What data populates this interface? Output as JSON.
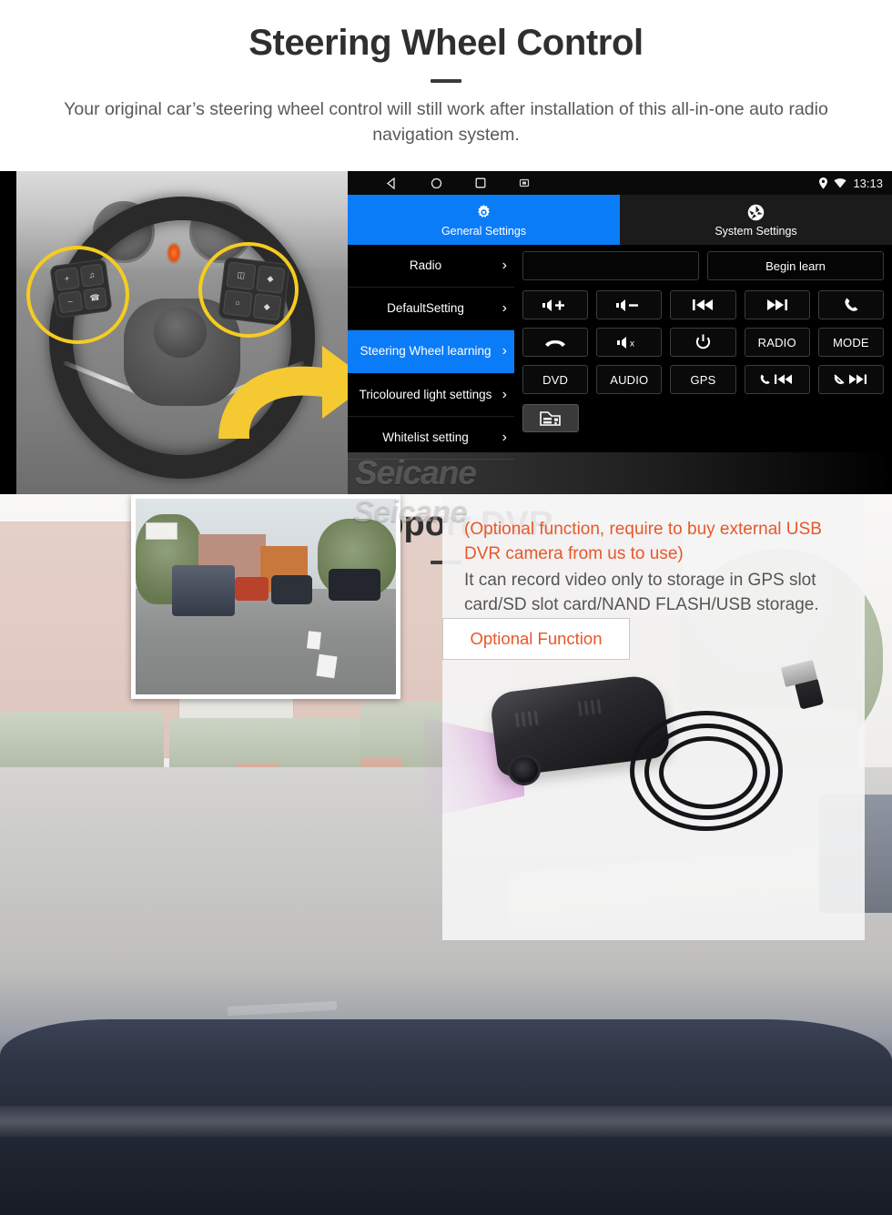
{
  "section_steering": {
    "title": "Steering Wheel Control",
    "subtitle": "Your original car’s steering wheel control will still work after installation of this all-in-one auto radio navigation system."
  },
  "android_ui": {
    "statusbar": {
      "time": "13:13",
      "nav_icons": [
        "back-triangle-icon",
        "home-circle-icon",
        "recents-square-icon",
        "screenshot-icon"
      ],
      "status_icons": [
        "location-pin-icon",
        "wifi-icon"
      ]
    },
    "tabs": [
      {
        "label": "General Settings",
        "icon": "gear-icon",
        "active": true
      },
      {
        "label": "System Settings",
        "icon": "pinwheel-icon",
        "active": false
      }
    ],
    "menu_items": [
      {
        "label": "Radio",
        "selected": false
      },
      {
        "label": "DefaultSetting",
        "selected": false
      },
      {
        "label": "Steering Wheel learning",
        "selected": true
      },
      {
        "label": "Tricoloured light settings",
        "selected": false
      },
      {
        "label": "Whitelist setting",
        "selected": false
      }
    ],
    "learn_field_value": "",
    "begin_learn_label": "Begin learn",
    "function_buttons": [
      {
        "label": "",
        "icon": "volume-up-icon"
      },
      {
        "label": "",
        "icon": "volume-down-icon"
      },
      {
        "label": "",
        "icon": "previous-track-icon"
      },
      {
        "label": "",
        "icon": "next-track-icon"
      },
      {
        "label": "",
        "icon": "phone-answer-icon"
      },
      {
        "label": "",
        "icon": "phone-hangup-icon"
      },
      {
        "label": "",
        "icon": "volume-mute-icon"
      },
      {
        "label": "",
        "icon": "power-icon"
      },
      {
        "label": "RADIO",
        "icon": ""
      },
      {
        "label": "MODE",
        "icon": ""
      },
      {
        "label": "DVD",
        "icon": ""
      },
      {
        "label": "AUDIO",
        "icon": ""
      },
      {
        "label": "GPS",
        "icon": ""
      },
      {
        "label": "",
        "icon": "phone-previous-icon"
      },
      {
        "label": "",
        "icon": "phone-reject-next-icon"
      }
    ],
    "car_button_icon": "car-front-icon",
    "watermark": "Seicane",
    "accent_color": "#0b7cf7"
  },
  "section_dvr": {
    "title": "Support DVR",
    "note_orange": "(Optional function, require to buy external USB DVR camera from us to use)",
    "note_gray": "It can record video only to storage in GPS slot card/SD slot card/NAND FLASH/USB storage.",
    "optional_button_label": "Optional Function",
    "watermark": "Seicane",
    "orange_color": "#e8572a"
  }
}
